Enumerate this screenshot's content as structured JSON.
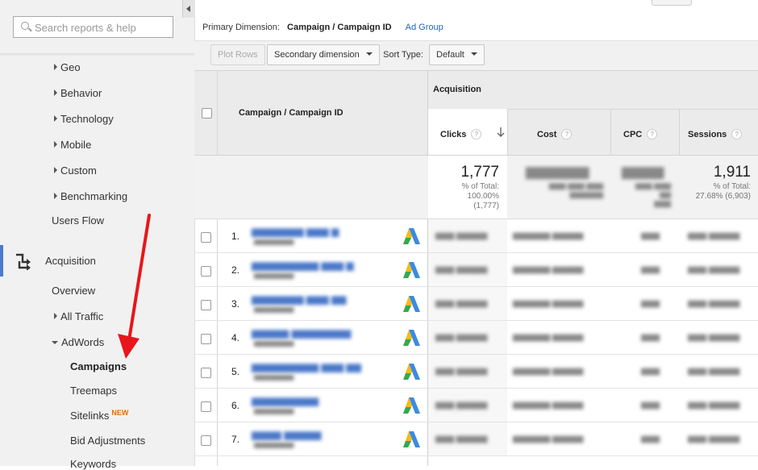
{
  "sidebar": {
    "search_placeholder": "Search reports & help",
    "items": [
      {
        "label": "Geo"
      },
      {
        "label": "Behavior"
      },
      {
        "label": "Technology"
      },
      {
        "label": "Mobile"
      },
      {
        "label": "Custom"
      },
      {
        "label": "Benchmarking"
      },
      {
        "label": "Users Flow"
      },
      {
        "label": "Acquisition"
      },
      {
        "label": "Overview"
      },
      {
        "label": "All Traffic"
      },
      {
        "label": "AdWords"
      },
      {
        "label": "Campaigns"
      },
      {
        "label": "Treemaps"
      },
      {
        "label": "Sitelinks"
      },
      {
        "label": "Bid Adjustments"
      },
      {
        "label": "Keywords"
      }
    ],
    "new_badge": "NEW",
    "active_color": "#4a7bd0",
    "annotation_arrow_color": "#e8161b"
  },
  "dimension_bar": {
    "label": "Primary Dimension:",
    "current": "Campaign / Campaign ID",
    "alt_link": "Ad Group"
  },
  "toolbar": {
    "plot_rows": "Plot Rows",
    "secondary_dimension": "Secondary dimension",
    "sort_type_label": "Sort Type:",
    "sort_type_value": "Default"
  },
  "table": {
    "dimension_header": "Campaign / Campaign ID",
    "group_header": "Acquisition",
    "columns": [
      {
        "label": "Clicks",
        "sorted": "descending"
      },
      {
        "label": "Cost"
      },
      {
        "label": "CPC"
      },
      {
        "label": "Sessions"
      }
    ],
    "totals": {
      "clicks": {
        "value": "1,777",
        "pct_label": "% of Total:",
        "pct": "100.00%",
        "base": "(1,777)"
      },
      "sessions": {
        "value": "1,911",
        "pct_label": "% of Total:",
        "pct": "27.68% (6,903)"
      }
    },
    "row_numbers": [
      "1.",
      "2.",
      "3.",
      "4.",
      "5.",
      "6.",
      "7."
    ],
    "icon": "adwords-logo-icon"
  }
}
